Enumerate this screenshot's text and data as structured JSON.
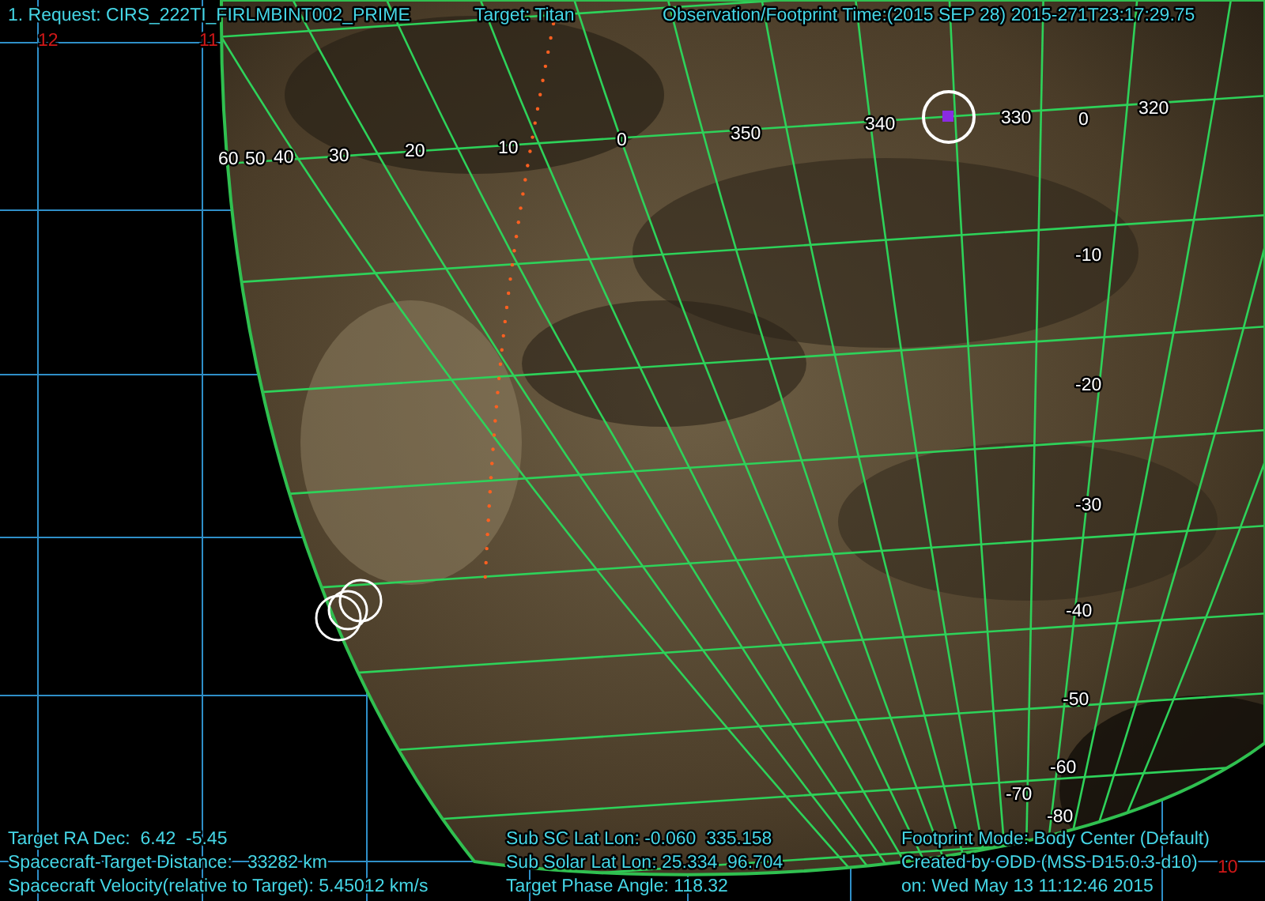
{
  "header": {
    "request": "1. Request: CIRS_222TI_FIRLMBINT002_PRIME",
    "target": "Target: Titan",
    "time": "Observation/Footprint Time:(2015 SEP 28) 2015-271T23:17:29.75"
  },
  "sky_grid_labels": [
    "12",
    "11",
    "10"
  ],
  "longitude_labels": [
    "60",
    "50",
    "40",
    "30",
    "20",
    "10",
    "0",
    "350",
    "340",
    "330",
    "0",
    "320"
  ],
  "latitude_labels": [
    "-10",
    "-20",
    "-30",
    "-40",
    "-50",
    "-60",
    "-70",
    "-80"
  ],
  "info_left": [
    "Target RA Dec:  6.42  -5.45",
    "Spacecraft-Target Distance:   33282 km",
    "Spacecraft Velocity(relative to Target): 5.45012 km/s"
  ],
  "info_middle": [
    "Sub SC Lat Lon: -0.060  335.158",
    "Sub Solar Lat Lon: 25.334  96.704",
    "Target Phase Angle: 118.32"
  ],
  "info_right": [
    "Footprint Mode: Body Center (Default)",
    "Created by ODD (MSS D15.0.3-d10)",
    "on: Wed May 13 11:12:46 2015"
  ]
}
